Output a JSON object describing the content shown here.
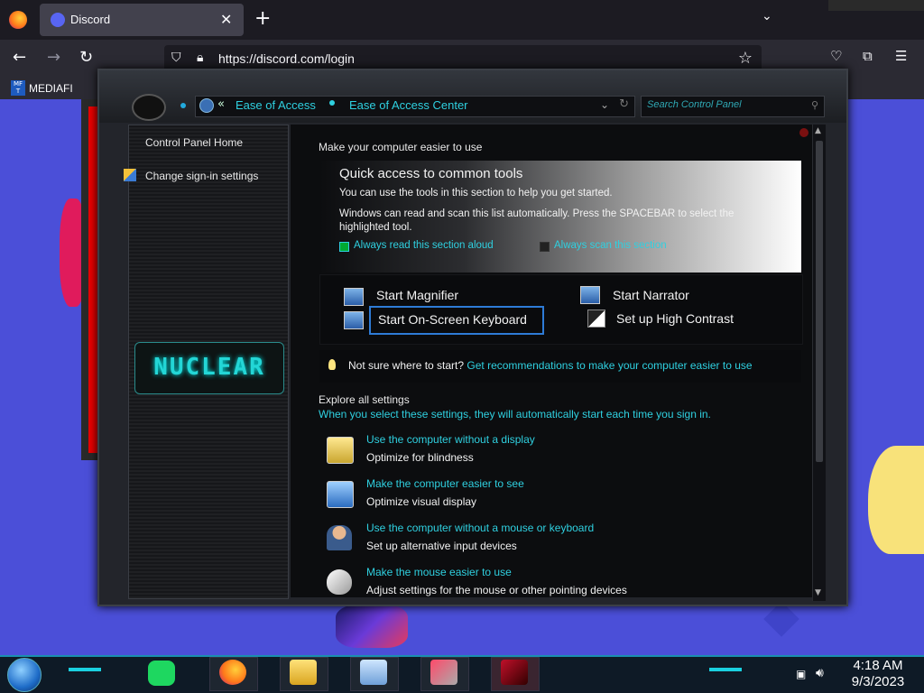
{
  "browser": {
    "tab_title": "Discord",
    "url": "https://discord.com/login",
    "bookmark": "MEDIAFI",
    "bookmark_icon_text": "MF T",
    "icons": {
      "back": "arrow-left-icon",
      "forward": "arrow-right-icon",
      "reload": "reload-icon",
      "star": "star-icon"
    }
  },
  "control_panel": {
    "breadcrumb": [
      "Ease of Access",
      "Ease of Access Center"
    ],
    "search_placeholder": "Search Control Panel",
    "left_nav": {
      "home": "Control Panel Home",
      "signin": "Change sign-in settings",
      "theme_logo": "NUCLEAR"
    },
    "content": {
      "title": "Make your computer easier to use",
      "quick_access": {
        "heading": "Quick access to common tools",
        "desc1": "You can use the tools in this section to help you get started.",
        "desc2": "Windows can read and scan this list automatically.  Press the SPACEBAR to select the highlighted tool.",
        "option1": "Always read this section aloud",
        "option2": "Always scan this section"
      },
      "tools": {
        "magnifier": "Start Magnifier",
        "narrator": "Start Narrator",
        "keyboard": "Start On-Screen Keyboard",
        "contrast": "Set up High Contrast"
      },
      "hint": {
        "text": "Not sure where to start?",
        "link": "Get recommendations to make your computer easier to use"
      },
      "explore": {
        "title": "Explore all settings",
        "subtitle": "When you select these settings, they will automatically start each time you sign in."
      },
      "settings": [
        {
          "link": "Use the computer without a display",
          "desc": "Optimize for blindness"
        },
        {
          "link": "Make the computer easier to see",
          "desc": "Optimize visual display"
        },
        {
          "link": "Use the computer without a mouse or keyboard",
          "desc": "Set up alternative input devices"
        },
        {
          "link": "Make the mouse easier to use",
          "desc": "Adjust settings for the mouse or other pointing devices"
        }
      ]
    }
  },
  "taskbar": {
    "time": "4:18 AM",
    "date": "9/3/2023"
  },
  "colors": {
    "accent": "#2fd0e0",
    "desktop": "#4b4fd8"
  }
}
